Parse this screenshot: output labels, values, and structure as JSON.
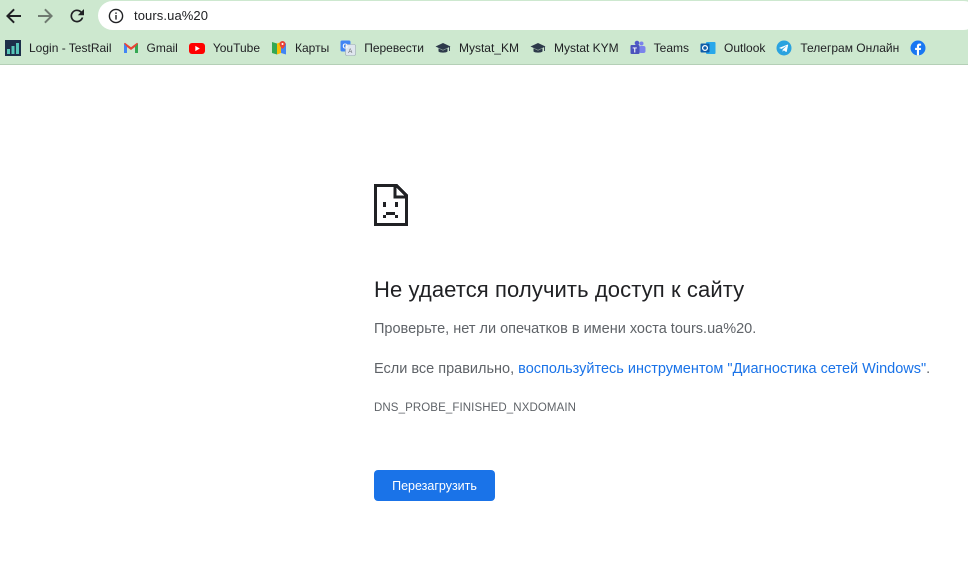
{
  "toolbar": {
    "url": "tours.ua%20",
    "icons": [
      "back-arrow-icon",
      "forward-arrow-icon",
      "reload-icon",
      "info-icon"
    ]
  },
  "bookmarks": [
    {
      "label": "Login - TestRail",
      "icon": "testrail-icon"
    },
    {
      "label": "Gmail",
      "icon": "gmail-icon"
    },
    {
      "label": "YouTube",
      "icon": "youtube-icon"
    },
    {
      "label": "Карты",
      "icon": "maps-icon"
    },
    {
      "label": "Перевести",
      "icon": "translate-icon"
    },
    {
      "label": "Mystat_KM",
      "icon": "graduation-cap-icon"
    },
    {
      "label": "Mystat KYM",
      "icon": "graduation-cap-icon"
    },
    {
      "label": "Teams",
      "icon": "teams-icon"
    },
    {
      "label": "Outlook",
      "icon": "outlook-icon"
    },
    {
      "label": "Телеграм Онлайн",
      "icon": "telegram-icon"
    },
    {
      "label": "",
      "icon": "facebook-icon"
    }
  ],
  "error": {
    "title": "Не удается получить доступ к сайту",
    "line1": "Проверьте, нет ли опечатков в имени хоста tours.ua%20.",
    "line2_prefix": "Если все правильно, ",
    "line2_link": "воспользуйтесь инструментом \"Диагностика сетей Windows\"",
    "line2_suffix": ".",
    "code": "DNS_PROBE_FINISHED_NXDOMAIN",
    "reload_label": "Перезагрузить"
  },
  "colors": {
    "browser_chrome": "#cde8cf",
    "link": "#1a73e8",
    "button": "#1a73e8",
    "title_text": "#202124",
    "body_text": "#5f6368"
  }
}
